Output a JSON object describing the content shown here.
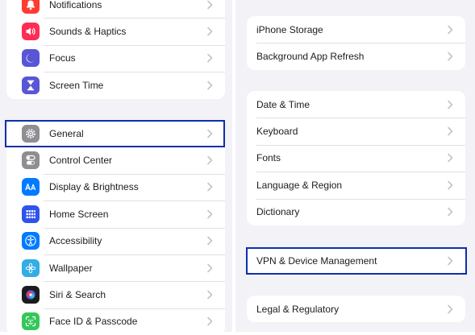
{
  "left_groups": [
    {
      "items": [
        {
          "label": "Notifications",
          "icon": "bell-icon",
          "color": "#ff3b30"
        },
        {
          "label": "Sounds & Haptics",
          "icon": "speaker-icon",
          "color": "#ff2d55"
        },
        {
          "label": "Focus",
          "icon": "moon-icon",
          "color": "#5856d6"
        },
        {
          "label": "Screen Time",
          "icon": "hourglass-icon",
          "color": "#5856d6"
        }
      ]
    },
    {
      "items": [
        {
          "label": "General",
          "icon": "gear-icon",
          "color": "#8e8e93",
          "highlighted": true
        },
        {
          "label": "Control Center",
          "icon": "toggles-icon",
          "color": "#8e8e93"
        },
        {
          "label": "Display & Brightness",
          "icon": "text-size-icon",
          "color": "#007aff"
        },
        {
          "label": "Home Screen",
          "icon": "app-grid-icon",
          "color": "#2f54eb"
        },
        {
          "label": "Accessibility",
          "icon": "accessibility-icon",
          "color": "#007aff"
        },
        {
          "label": "Wallpaper",
          "icon": "flower-icon",
          "color": "#32ade6"
        },
        {
          "label": "Siri & Search",
          "icon": "siri-icon",
          "color": "#1c1c1e"
        },
        {
          "label": "Face ID & Passcode",
          "icon": "face-id-icon",
          "color": "#34c759"
        }
      ]
    }
  ],
  "right_groups": [
    {
      "items": [
        {
          "label": "iPhone Storage"
        },
        {
          "label": "Background App Refresh"
        }
      ]
    },
    {
      "items": [
        {
          "label": "Date & Time"
        },
        {
          "label": "Keyboard"
        },
        {
          "label": "Fonts"
        },
        {
          "label": "Language & Region"
        },
        {
          "label": "Dictionary"
        }
      ]
    },
    {
      "items": [
        {
          "label": "VPN & Device Management",
          "highlighted": true
        }
      ]
    },
    {
      "items": [
        {
          "label": "Legal & Regulatory"
        }
      ]
    }
  ],
  "colors": {
    "background": "#f2f2f7",
    "highlight_border": "#0f2fa8",
    "chevron": "#c4c4c7"
  }
}
